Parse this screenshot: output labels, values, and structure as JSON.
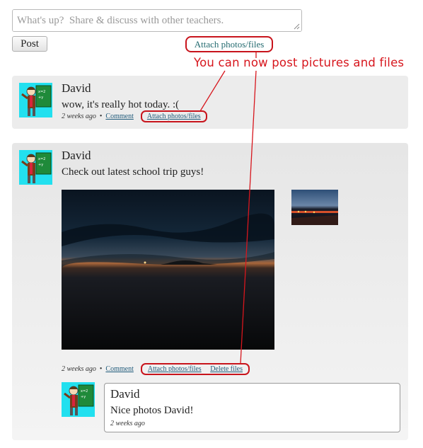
{
  "composer": {
    "placeholder": "What's up?  Share & discuss with other teachers.",
    "post_label": "Post",
    "attach_label": "Attach photos/files"
  },
  "annotation": {
    "text": "You can now post pictures and files",
    "color": "#d7161d"
  },
  "posts": [
    {
      "author": "David",
      "text": "wow, it's really hot today. :(",
      "time": "2 weeks ago",
      "comment_label": "Comment",
      "attach_label": "Attach photos/files"
    },
    {
      "author": "David",
      "text": "Check out latest school trip guys!",
      "time": "2 weeks ago",
      "comment_label": "Comment",
      "attach_label": "Attach photos/files",
      "delete_label": "Delete files",
      "comments": [
        {
          "author": "David",
          "text": "Nice photos David!",
          "time": "2 weeks ago"
        }
      ]
    }
  ],
  "colors": {
    "link": "#246b70",
    "card_bg": "#ececec",
    "avatar_bg": "#22e0ef",
    "highlight": "#c8141c"
  }
}
